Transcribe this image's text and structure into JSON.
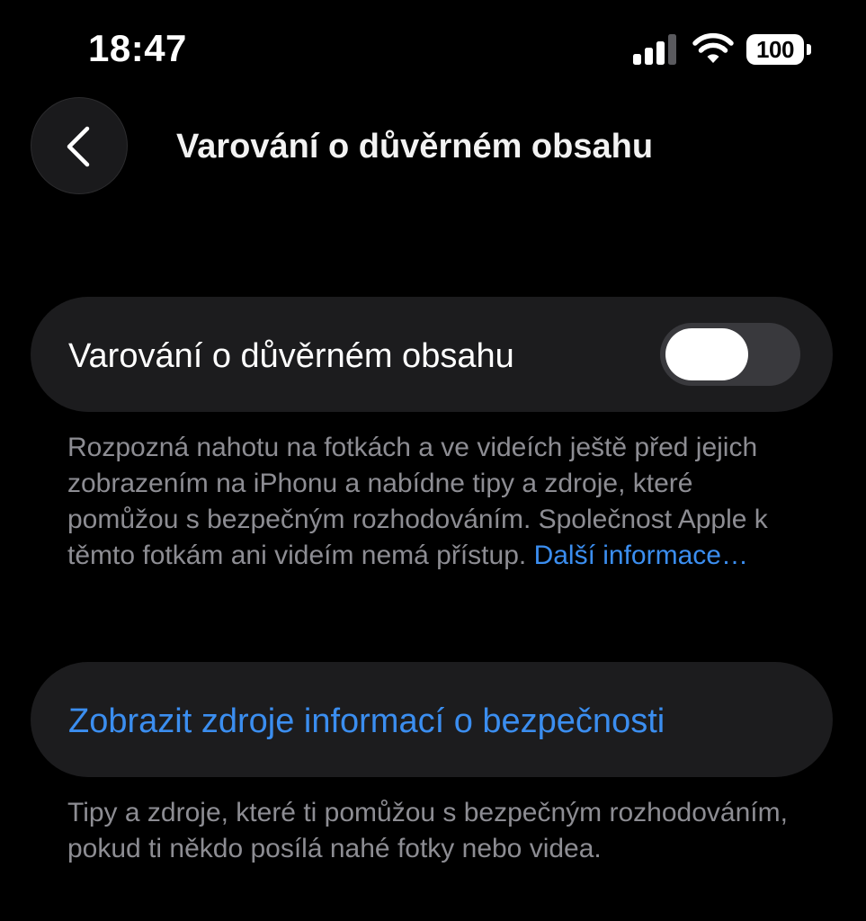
{
  "status_bar": {
    "time": "18:47",
    "battery_level": "100",
    "signal_bars": 3,
    "icons": [
      "signal-icon",
      "wifi-icon",
      "battery-icon"
    ]
  },
  "nav": {
    "back_icon": "chevron-left-icon",
    "title": "Varování o důvěrném obsahu"
  },
  "toggle_row": {
    "label": "Varování o důvěrném obsahu",
    "state": "off"
  },
  "footer_1": {
    "text": "Rozpozná nahotu na fotkách a ve videích ještě před jejich zobrazením na iPhonu a nabídne tipy a zdroje, které pomůžou s bezpečným rozhodováním. Společnost Apple k těmto fotkám ani videím nemá přístup. ",
    "link": "Další informace…"
  },
  "resources_row": {
    "label": "Zobrazit zdroje informací o bezpečnosti"
  },
  "footer_2": {
    "text": "Tipy a zdroje, které ti pomůžou s bezpečným rozhodováním, pokud ti někdo posílá nahé fotky nebo videa."
  },
  "colors": {
    "background": "#000000",
    "card": "#1c1c1e",
    "link": "#3b8ef0",
    "secondary_text": "#8d8d93",
    "toggle_off": "#39393d"
  }
}
